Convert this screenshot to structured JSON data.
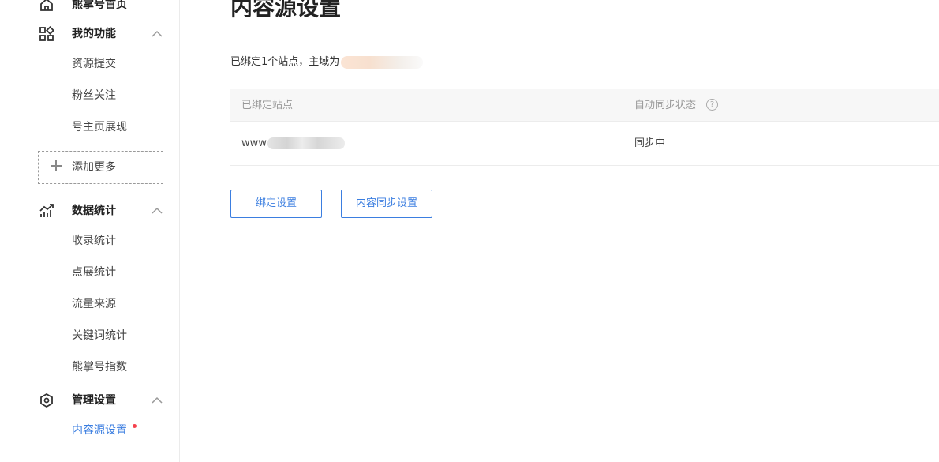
{
  "sidebar": {
    "groups": [
      {
        "label": "熊掌号首页",
        "icon": "home-icon"
      },
      {
        "label": "我的功能",
        "icon": "grid-icon",
        "items": [
          "资源提交",
          "粉丝关注",
          "号主页展现"
        ]
      },
      {
        "label": "数据统计",
        "icon": "chart-icon",
        "items": [
          "收录统计",
          "点展统计",
          "流量来源",
          "关键词统计",
          "熊掌号指数"
        ]
      },
      {
        "label": "管理设置",
        "icon": "settings-icon",
        "items": [
          "内容源设置"
        ]
      }
    ],
    "add_more_label": "添加更多",
    "active_item": "内容源设置",
    "accent": "#3b7ee0",
    "notification_dot_color": "#f5414d"
  },
  "main": {
    "title": "内容源设置",
    "bind_info": "已绑定1个站点，主域为",
    "table": {
      "headers": [
        "已绑定站点",
        "自动同步状态"
      ],
      "rows": [
        {
          "site": "www",
          "status": "同步中"
        }
      ]
    },
    "buttons": {
      "bind_settings": "绑定设置",
      "sync_settings": "内容同步设置"
    }
  }
}
